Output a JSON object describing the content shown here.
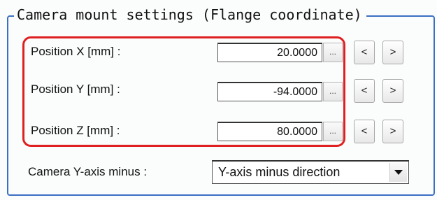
{
  "group": {
    "title": "Camera mount settings (Flange coordinate)"
  },
  "fields": [
    {
      "label": "Position X [mm] :",
      "value": "20.0000",
      "ellipsis": "...",
      "dec": "<",
      "inc": ">"
    },
    {
      "label": "Position Y [mm] :",
      "value": "-94.0000",
      "ellipsis": "...",
      "dec": "<",
      "inc": ">"
    },
    {
      "label": "Position Z [mm] :",
      "value": "80.0000",
      "ellipsis": "...",
      "dec": "<",
      "inc": ">"
    }
  ],
  "camera_y_axis": {
    "label": "Camera Y-axis minus :",
    "selected": "Y-axis minus direction"
  },
  "icons": {
    "dropdown": "chevron-down-icon"
  },
  "colors": {
    "group_border": "#3b6fc4",
    "highlight": "#e02020"
  }
}
